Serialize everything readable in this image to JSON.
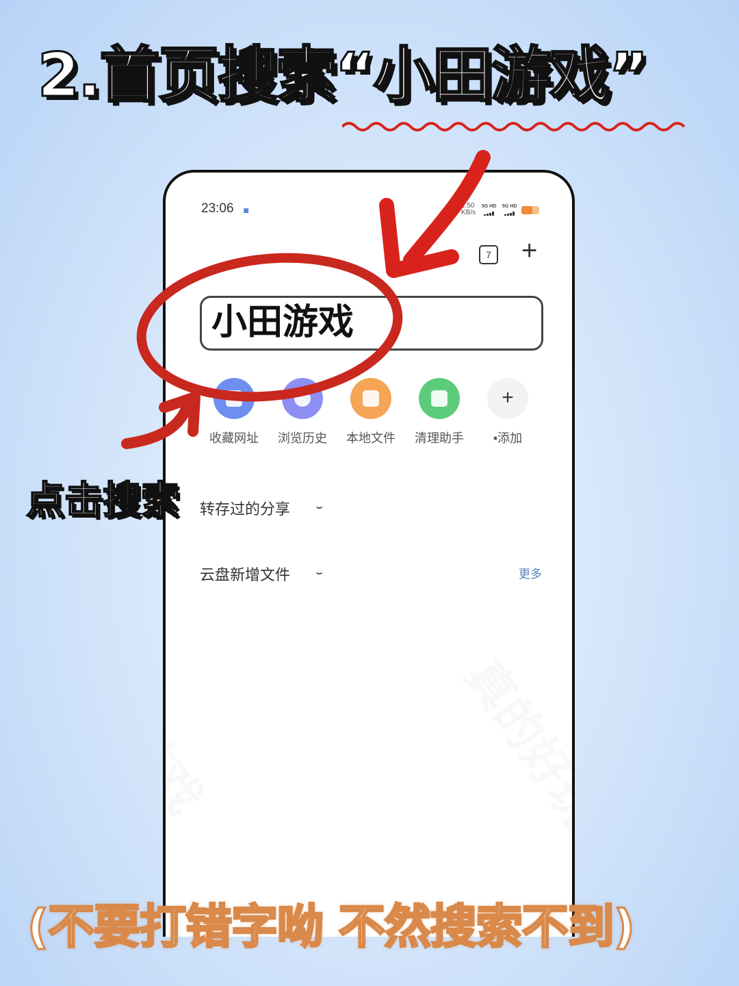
{
  "header": {
    "title": "2.首页搜索“小田游戏”"
  },
  "status_bar": {
    "time": "23:06",
    "speed": "1.50 KB/s",
    "net1": "5G HD",
    "net2": "5G HD"
  },
  "toolbar": {
    "tab_count": "7",
    "add_icon": "plus-icon",
    "tabs_icon": "tabs-icon"
  },
  "search": {
    "value": "小田游戏"
  },
  "shortcuts": [
    {
      "label": "收藏网址",
      "color": "#6e8ff0"
    },
    {
      "label": "浏览历史",
      "color": "#8d8ff3"
    },
    {
      "label": "本地文件",
      "color": "#f5a555"
    },
    {
      "label": "清理助手",
      "color": "#5ccc7a"
    },
    {
      "label": "•添加",
      "color": "#f2f2f2"
    }
  ],
  "sections": {
    "saved_shares": "转存过的分享",
    "cloud_new": "云盘新增文件",
    "more": "更多"
  },
  "annotation": {
    "click_search": "点击搜索",
    "bottom_note": "(不要打错字呦 不然搜索不到)"
  },
  "colors": {
    "annotation_red": "#c9281e",
    "background": "#cfe2f9"
  }
}
